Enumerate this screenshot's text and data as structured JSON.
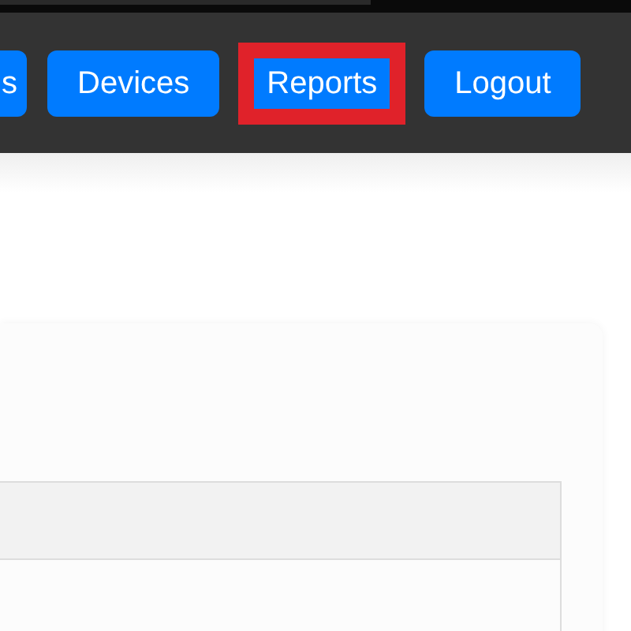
{
  "nav": {
    "items": [
      {
        "label": "s",
        "selected": false,
        "cut": true
      },
      {
        "label": "Devices",
        "selected": false,
        "cut": false
      },
      {
        "label": "Reports",
        "selected": true,
        "cut": false
      },
      {
        "label": "Logout",
        "selected": false,
        "cut": false
      }
    ]
  }
}
